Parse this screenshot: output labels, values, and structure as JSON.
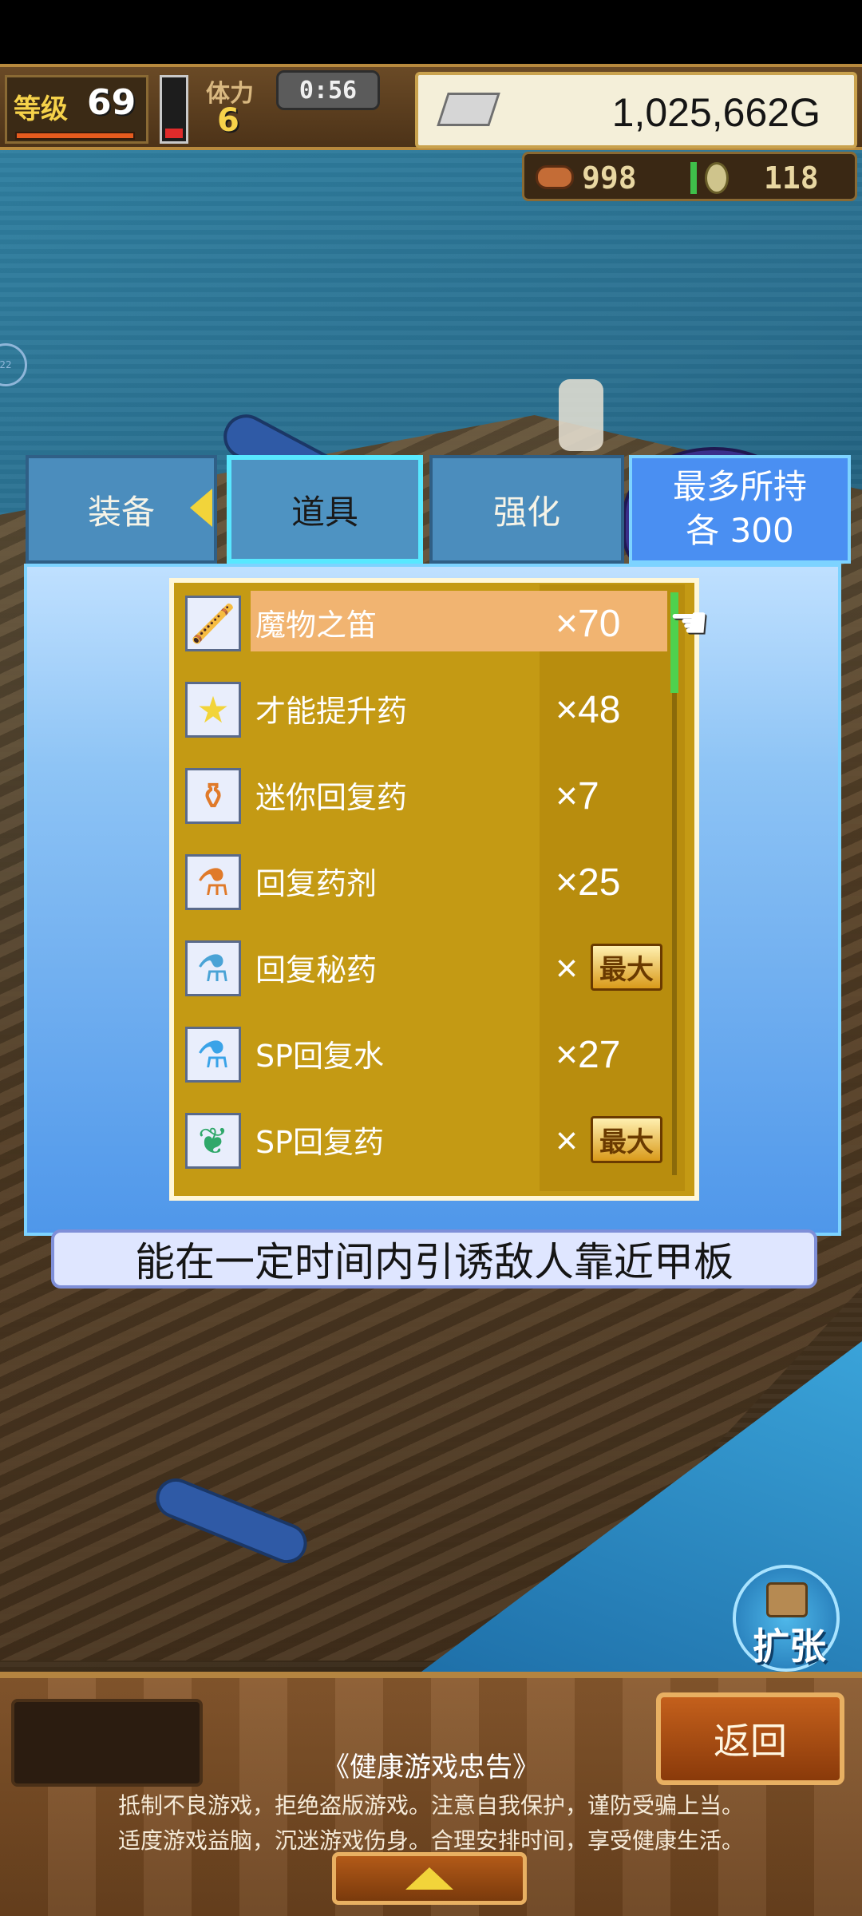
{
  "hud": {
    "level_label": "等级",
    "level_value": "69",
    "stamina_label": "体力",
    "stamina_value": "6",
    "timer": "0:56",
    "gold": "1,025,662G",
    "resource_meat": "998",
    "resource_coin": "118"
  },
  "tabs": {
    "equip": "装备",
    "items": "道具",
    "enhance": "强化",
    "max_line1": "最多所持",
    "max_line2": "各 300"
  },
  "items": [
    {
      "name": "魔物之笛",
      "qty": "×70",
      "icon": "flute-icon",
      "selected": true
    },
    {
      "name": "才能提升药",
      "qty": "×48",
      "icon": "star-icon"
    },
    {
      "name": "迷你回复药",
      "qty": "×7",
      "icon": "small-potion-icon"
    },
    {
      "name": "回复药剂",
      "qty": "×25",
      "icon": "potion-icon"
    },
    {
      "name": "回复秘药",
      "qty": "×",
      "max_badge": "最大",
      "icon": "secret-potion-icon"
    },
    {
      "name": "SP回复水",
      "qty": "×27",
      "icon": "sp-water-icon"
    },
    {
      "name": "SP回复药",
      "qty": "×",
      "max_badge": "最大",
      "icon": "sp-herb-icon"
    }
  ],
  "description": "能在一定时间内引诱敌人靠近甲板",
  "expand_label": "扩张",
  "footer": {
    "back_label": "返回",
    "advice_title": "《健康游戏忠告》",
    "advice_line1": "抵制不良游戏，拒绝盗版游戏。注意自我保护，谨防受骗上当。",
    "advice_line2": "适度游戏益脑，沉迷游戏伤身。合理安排时间，享受健康生活。"
  },
  "side_badge": "22",
  "colors": {
    "panel_blue": "#4f97ea",
    "list_gold": "#c49a14",
    "selected_row": "#f1b471",
    "tab_highlight": "#58e8ff"
  }
}
